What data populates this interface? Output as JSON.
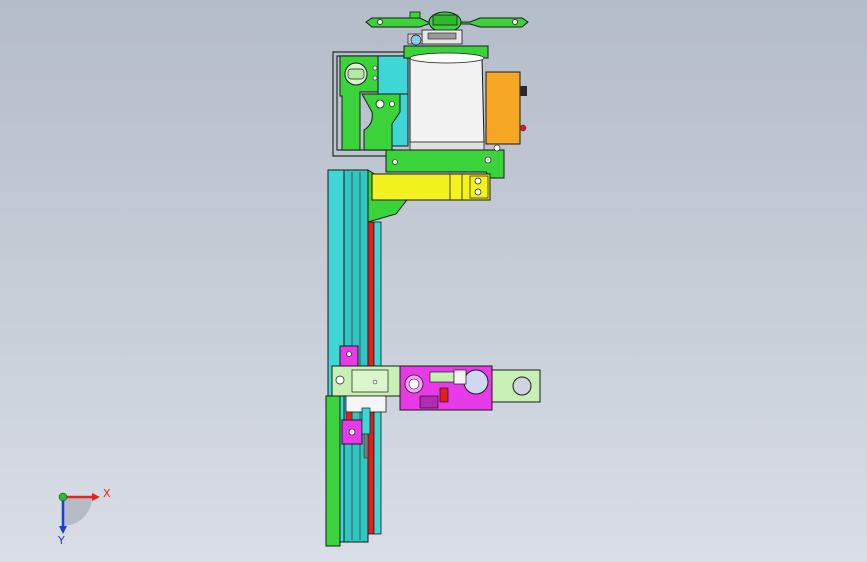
{
  "viewport": {
    "background_top": "#b3bcc9",
    "background_bottom": "#d9dee6"
  },
  "triad": {
    "x_label": "X",
    "y_label": "Y",
    "x_color": "#e8231c",
    "y_color": "#1b3ecf",
    "z_color": "#2bbd2b"
  },
  "colors": {
    "green": "#3ad43a",
    "cyan": "#3fd6d6",
    "yellow": "#f2f21e",
    "orange": "#f5a623",
    "magenta": "#e83ae8",
    "red": "#e02020",
    "lightgreen": "#c8f0b4",
    "motor_white": "#f2f2f2",
    "outline": "#1a1a1a"
  },
  "icons": [
    "coordinate-triad-icon"
  ]
}
